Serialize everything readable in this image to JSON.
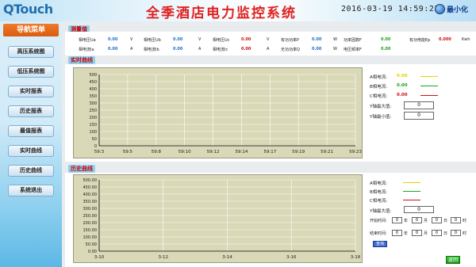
{
  "header": {
    "logo": "QTouch",
    "title": "全季酒店电力监控系统",
    "datetime": "2016-03-19 14:59:23",
    "minimize_label": "最小化"
  },
  "sidebar": {
    "title": "导航菜单",
    "items": [
      {
        "label": "高压系统图"
      },
      {
        "label": "低压系统图"
      },
      {
        "label": "实时报表"
      },
      {
        "label": "历史报表"
      },
      {
        "label": "最值报表"
      },
      {
        "label": "实时曲线"
      },
      {
        "label": "历史曲线"
      },
      {
        "label": "系统退出"
      }
    ]
  },
  "measure": {
    "section_label": "测量值",
    "row1": [
      {
        "label": "相电压Ua",
        "value": "0.00",
        "unit": "V",
        "color": "#1e6fd0"
      },
      {
        "label": "相电压Ub",
        "value": "0.00",
        "unit": "V",
        "color": "#1e6fd0"
      },
      {
        "label": "相电压Uc",
        "value": "0.00",
        "unit": "V",
        "color": "#d01010"
      },
      {
        "label": "有功功率P",
        "value": "0.00",
        "unit": "W",
        "color": "#1e6fd0"
      },
      {
        "label": "功率因数F",
        "value": "0.00",
        "unit": "",
        "color": "#1aa51a"
      },
      {
        "label": "有功电能Ep",
        "value": "0.000",
        "unit": "Kwh",
        "color": "#d01010"
      }
    ],
    "row2": [
      {
        "label": "相电流Ia",
        "value": "0.00",
        "unit": "A",
        "color": "#1e6fd0"
      },
      {
        "label": "相电流Ib",
        "value": "0.00",
        "unit": "A",
        "color": "#1e6fd0"
      },
      {
        "label": "相电流Ic",
        "value": "0.00",
        "unit": "A",
        "color": "#d01010"
      },
      {
        "label": "无功功率Q",
        "value": "0.00",
        "unit": "W",
        "color": "#1e6fd0"
      },
      {
        "label": "电压频率F",
        "value": "0.00",
        "unit": "",
        "color": "#1aa51a"
      }
    ]
  },
  "realtime": {
    "section_label": "实时曲线",
    "y_ticks": [
      "500",
      "450",
      "400",
      "350",
      "300",
      "250",
      "200",
      "150",
      "100",
      "50",
      "0"
    ],
    "x_ticks": [
      "59:3",
      "59:5",
      "59:8",
      "59:10",
      "59:12",
      "59:14",
      "59:17",
      "59:19",
      "59:21",
      "59:23"
    ],
    "legend": [
      {
        "label": "A相电流:",
        "value": "0.00",
        "color": "#e8d000"
      },
      {
        "label": "B相电流:",
        "value": "0.00",
        "color": "#1aa51a"
      },
      {
        "label": "C相电流:",
        "value": "0.00",
        "color": "#d01010"
      }
    ],
    "ymax_label": "Y轴最大值:",
    "ymax_value": "0",
    "ymin_label": "Y轴最小值:",
    "ymin_value": "0"
  },
  "history": {
    "section_label": "历史曲线",
    "y_ticks": [
      "500.00",
      "450.00",
      "400.00",
      "350.00",
      "300.00",
      "250.00",
      "200.00",
      "150.00",
      "100.00",
      "50.00",
      "0.00"
    ],
    "x_ticks": [
      "3-10",
      "3-12",
      "3-14",
      "3-16",
      "3-18"
    ],
    "legend": [
      {
        "label": "A相电流:",
        "color": "#e8d000"
      },
      {
        "label": "B相电流:",
        "color": "#1aa51a"
      },
      {
        "label": "C相电流:",
        "color": "#d01010"
      }
    ],
    "ymax_label": "Y轴最大值:",
    "ymax_value": "0",
    "start_label": "开始时间:",
    "end_label": "结束时间:",
    "start_fields": [
      {
        "value": "0",
        "unit": "年"
      },
      {
        "value": "0",
        "unit": "月"
      },
      {
        "value": "0",
        "unit": "日"
      },
      {
        "value": "0",
        "unit": "时"
      }
    ],
    "end_fields": [
      {
        "value": "0",
        "unit": "年"
      },
      {
        "value": "0",
        "unit": "月"
      },
      {
        "value": "0",
        "unit": "日"
      },
      {
        "value": "0",
        "unit": "时"
      }
    ],
    "query_label": "查询",
    "return_label": "返回"
  }
}
